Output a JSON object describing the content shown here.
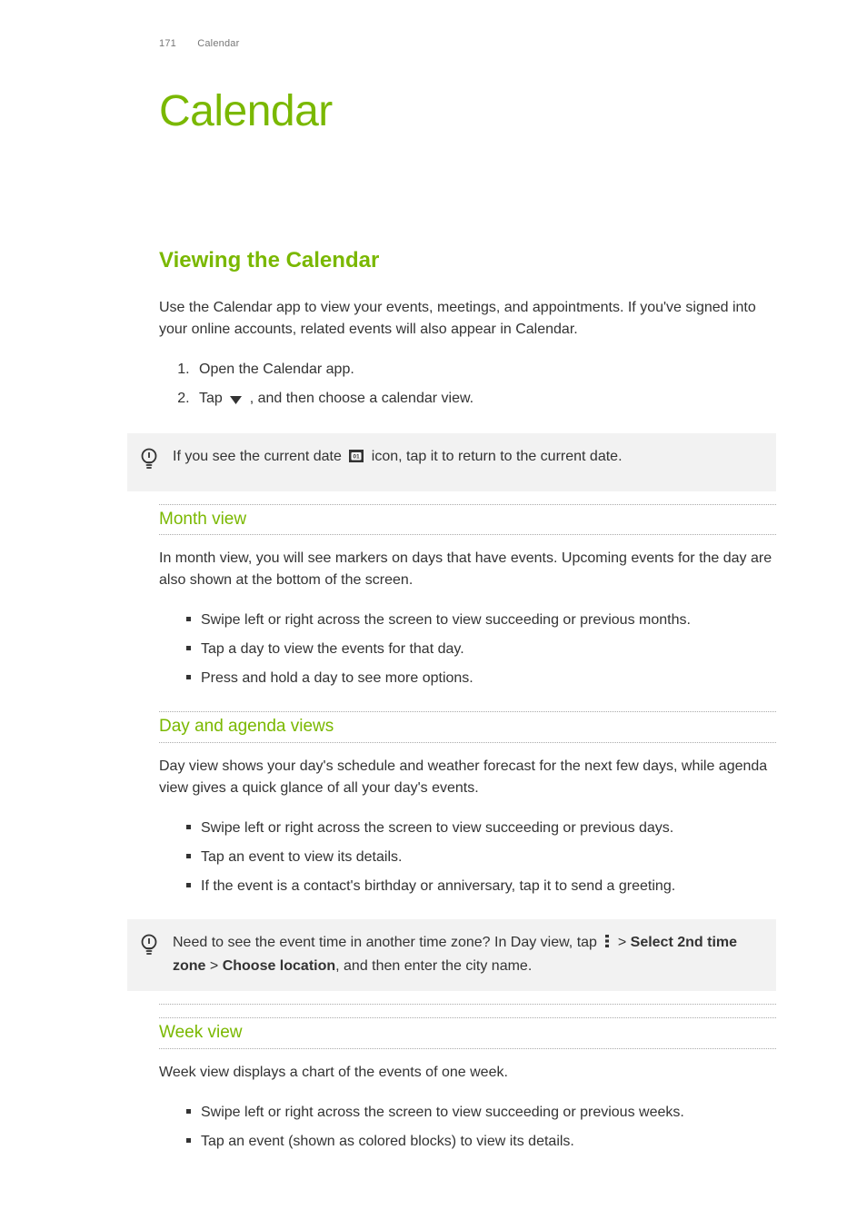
{
  "header": {
    "page_num": "171",
    "chapter_ref": "Calendar"
  },
  "chapter_title": "Calendar",
  "section1": {
    "title": "Viewing the Calendar",
    "intro": "Use the Calendar app to view your events, meetings, and appointments. If you've signed into your online accounts, related events will also appear in Calendar.",
    "steps": {
      "s1": "Open the Calendar app.",
      "s2_a": "Tap ",
      "s2_b": " , and then choose a calendar view."
    },
    "tip1_a": "If you see the current date ",
    "tip1_b": " icon, tap it to return to the current date."
  },
  "month": {
    "title": "Month view",
    "intro": "In month view, you will see markers on days that have events. Upcoming events for the day are also shown at the bottom of the screen.",
    "b1": "Swipe left or right across the screen to view succeeding or previous months.",
    "b2": "Tap a day to view the events for that day.",
    "b3": "Press and hold a day to see more options."
  },
  "day": {
    "title": "Day and agenda views",
    "intro": "Day view shows your day's schedule and weather forecast for the next few days, while agenda view gives a quick glance of all your day's events.",
    "b1": "Swipe left or right across the screen to view succeeding or previous days.",
    "b2": "Tap an event to view its details.",
    "b3": "If the event is a contact's birthday or anniversary, tap it to send a greeting.",
    "tip_a": "Need to see the event time in another time zone? In Day view, tap ",
    "tip_b": " > ",
    "tip_bold1": "Select 2nd time zone",
    "tip_c": " > ",
    "tip_bold2": "Choose location",
    "tip_d": ", and then enter the city name."
  },
  "week": {
    "title": "Week view",
    "intro": "Week view displays a chart of the events of one week.",
    "b1": "Swipe left or right across the screen to view succeeding or previous weeks.",
    "b2": "Tap an event (shown as colored blocks) to view its details."
  }
}
